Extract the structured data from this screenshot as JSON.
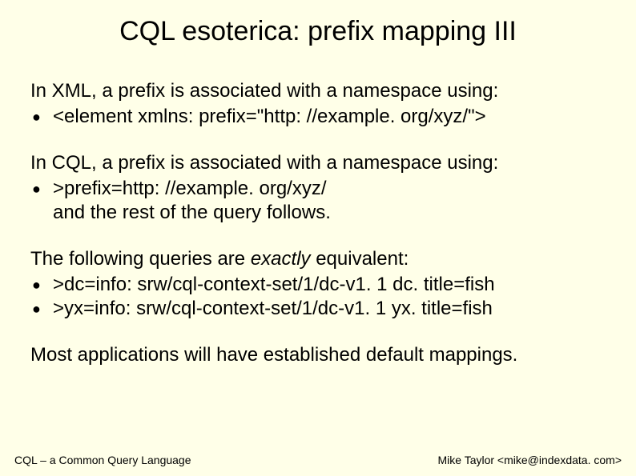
{
  "title": "CQL esoterica: prefix mapping III",
  "sections": [
    {
      "lead": "In XML, a prefix is associated with a namespace using:",
      "bullets": [
        {
          "text": "<element xmlns: prefix=\"http: //example. org/xyz/\">"
        }
      ]
    },
    {
      "lead": "In CQL, a prefix is associated with a namespace using:",
      "bullets": [
        {
          "text": ">prefix=http: //example. org/xyz/\nand the rest of the query follows."
        }
      ]
    },
    {
      "lead_pre": "The following queries are ",
      "lead_em": "exactly",
      "lead_post": " equivalent:",
      "bullets": [
        {
          "text": ">dc=info: srw/cql-context-set/1/dc-v1. 1 dc. title=fish"
        },
        {
          "text": ">yx=info: srw/cql-context-set/1/dc-v1. 1 yx. title=fish"
        }
      ]
    },
    {
      "lead": "Most applications will have established default mappings.",
      "bullets": []
    }
  ],
  "footer": {
    "left": "CQL – a Common Query Language",
    "right": "Mike Taylor <mike@indexdata. com>"
  }
}
